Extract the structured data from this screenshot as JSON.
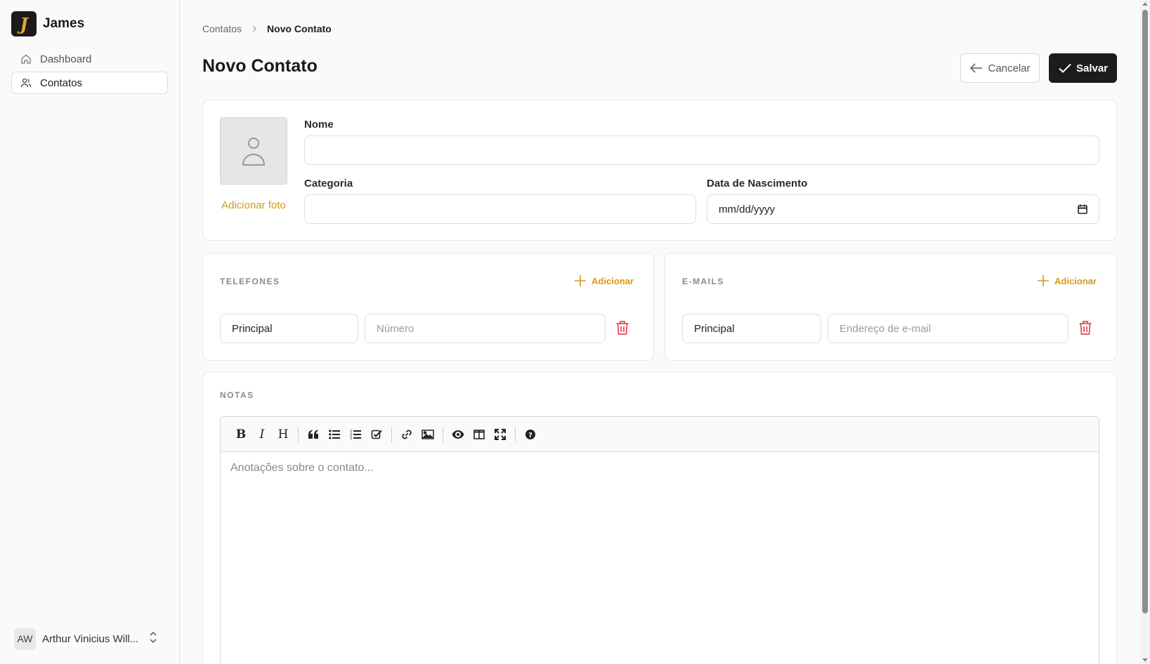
{
  "app": {
    "logo_letter": "J",
    "name": "James"
  },
  "sidebar": {
    "items": [
      {
        "label": "Dashboard",
        "icon": "home-icon",
        "active": false
      },
      {
        "label": "Contatos",
        "icon": "users-icon",
        "active": true
      }
    ],
    "user": {
      "initials": "AW",
      "name": "Arthur Vinicius Will..."
    }
  },
  "breadcrumb": {
    "parent": "Contatos",
    "current": "Novo Contato"
  },
  "page": {
    "title": "Novo Contato",
    "cancel_label": "Cancelar",
    "save_label": "Salvar"
  },
  "profile": {
    "add_photo_label": "Adicionar foto",
    "name_label": "Nome",
    "name_value": "",
    "category_label": "Categoria",
    "category_value": "",
    "birth_label": "Data de Nascimento",
    "birth_value": "mm/dd/yyyy"
  },
  "phones": {
    "title": "TELEFONES",
    "add_label": "Adicionar",
    "rows": [
      {
        "type": "Principal",
        "placeholder": "Número"
      }
    ]
  },
  "emails": {
    "title": "E-MAILS",
    "add_label": "Adicionar",
    "rows": [
      {
        "type": "Principal",
        "placeholder": "Endereço de e-mail"
      }
    ]
  },
  "notes": {
    "title": "NOTAS",
    "placeholder": "Anotações sobre o contato...",
    "toolbar": [
      "bold",
      "italic",
      "heading",
      "quote",
      "unordered-list",
      "ordered-list",
      "checklist",
      "link",
      "image",
      "preview",
      "side-by-side",
      "fullscreen",
      "help"
    ]
  },
  "colors": {
    "accent": "#d59a16",
    "primary_button": "#1c1c1c",
    "danger": "#e5484d"
  }
}
